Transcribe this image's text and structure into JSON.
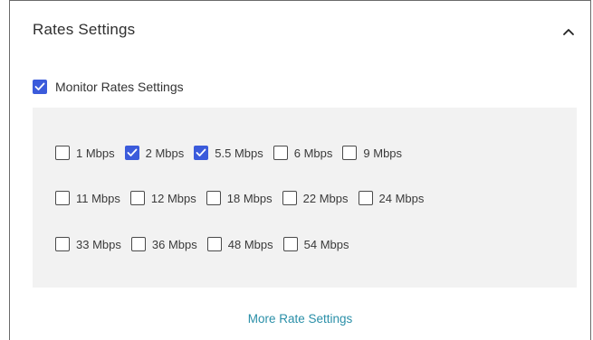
{
  "section": {
    "title": "Rates Settings",
    "collapse_icon": "chevron-up-icon"
  },
  "monitor": {
    "label": "Monitor Rates Settings",
    "checked": true
  },
  "rates": {
    "row1": [
      {
        "label": "1 Mbps",
        "checked": false
      },
      {
        "label": "2 Mbps",
        "checked": true
      },
      {
        "label": "5.5 Mbps",
        "checked": true
      },
      {
        "label": "6 Mbps",
        "checked": false
      },
      {
        "label": "9 Mbps",
        "checked": false
      }
    ],
    "row2": [
      {
        "label": "11 Mbps",
        "checked": false
      },
      {
        "label": "12 Mbps",
        "checked": false
      },
      {
        "label": "18 Mbps",
        "checked": false
      },
      {
        "label": "22 Mbps",
        "checked": false
      },
      {
        "label": "24 Mbps",
        "checked": false
      }
    ],
    "row3": [
      {
        "label": "33 Mbps",
        "checked": false
      },
      {
        "label": "36 Mbps",
        "checked": false
      },
      {
        "label": "48 Mbps",
        "checked": false
      },
      {
        "label": "54 Mbps",
        "checked": false
      }
    ]
  },
  "more_link": "More Rate Settings",
  "colors": {
    "accent": "#3b5bdb",
    "link": "#2a8fa8",
    "panel_bg": "#f2f2f2"
  }
}
